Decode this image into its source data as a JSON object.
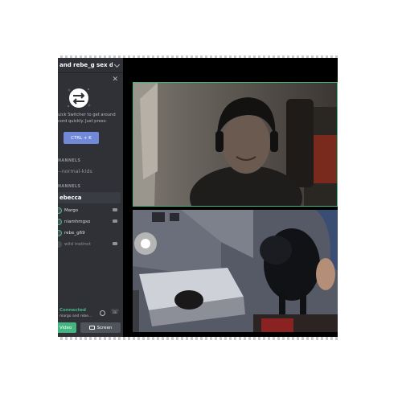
{
  "server": {
    "name": "and rebe_g sex du..."
  },
  "quick_switcher": {
    "text_line1": "uick Switcher to get around",
    "text_line2": "cord quickly. Just press:",
    "shortcut_label": "CTRL + K"
  },
  "channels": {
    "section1_label": "HANNELS",
    "text_channel": "--normal-kids",
    "section2_label": "HANNELS",
    "active_voice_channel": "ebecca"
  },
  "voice_users": [
    {
      "name": "Margo",
      "video": true
    },
    {
      "name": "niamhmgso",
      "video": true
    },
    {
      "name": "rebe_g69",
      "video": false
    },
    {
      "name": "wild instinct",
      "video": true
    }
  ],
  "connection": {
    "status": "Connected",
    "channel": "margo and rebe..."
  },
  "controls": {
    "video_label": "Video",
    "screen_label": "Screen"
  },
  "colors": {
    "connected_green": "#43b581",
    "blurple": "#7289da",
    "sidebar": "#2f3136"
  }
}
